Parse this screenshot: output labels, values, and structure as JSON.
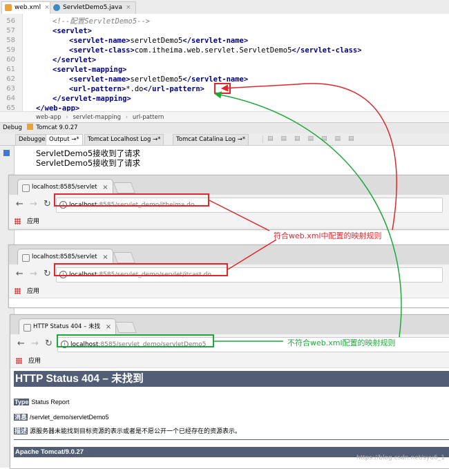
{
  "editor": {
    "tabs": [
      {
        "label": "web.xml",
        "close": "×"
      },
      {
        "label": "ServletDemo5.java",
        "close": "×"
      }
    ],
    "lines": [
      {
        "num": "56",
        "text": "<!--配置ServletDemo5-->"
      },
      {
        "num": "57",
        "text": "<servlet>"
      },
      {
        "num": "58",
        "open": "<servlet-name>",
        "value": "servletDemo5",
        "close": "</servlet-name>"
      },
      {
        "num": "59",
        "open": "<servlet-class>",
        "value": "com.itheima.web.servlet.ServletDemo5",
        "close": "</servlet-class>"
      },
      {
        "num": "60",
        "text": "</servlet>"
      },
      {
        "num": "61",
        "text": "<servlet-mapping>"
      },
      {
        "num": "62",
        "open": "<servlet-name>",
        "value": "servletDemo5",
        "close": "</servlet-name>"
      },
      {
        "num": "63",
        "open": "<url-pattern>",
        "value": "*.do",
        "close": "</url-pattern>"
      },
      {
        "num": "64",
        "text": "</servlet-mapping>"
      },
      {
        "num": "65",
        "text": "</web-app>"
      }
    ],
    "breadcrumb": [
      "web-app",
      "servlet-mapping",
      "url-pattern"
    ],
    "separator": "›"
  },
  "debug": {
    "label": "Debug",
    "config": "Tomcat 9.0.27",
    "tabs": [
      "Debugger",
      "Output →*",
      "Tomcat Localhost Log →*",
      "Tomcat Catalina Log →*"
    ],
    "console_lines": [
      "ServletDemo5接收到了请求",
      "ServletDemo5接收到了请求"
    ]
  },
  "browsers": [
    {
      "tab_title": "localhost:8585/servlet",
      "host": "localhost",
      "path": ":8585/servlet_demo/itheima.do",
      "apps": "应用"
    },
    {
      "tab_title": "localhost:8585/servlet",
      "host": "localhost",
      "path": ":8585/servlet_demo/servlet/itcast.do",
      "apps": "应用"
    },
    {
      "tab_title": "HTTP Status 404 – 未找",
      "host": "localhost",
      "path": ":8585/servlet_demo/servletDemo5",
      "apps": "应用"
    }
  ],
  "page404": {
    "heading": "HTTP Status 404 – 未找到",
    "type_label": "Type",
    "type_value": "Status Report",
    "message_label": "消息",
    "message_value": "/servlet_demo/servletDemo5",
    "desc_label": "描述",
    "desc_value": "源服务器未能找到目标资源的表示或者是不愿公开一个已经存在的资源表示。",
    "footer": "Apache Tomcat/9.0.27"
  },
  "annotations": {
    "match": "符合web.xml中配置的映射规则",
    "nomatch": "不符合web.xml配置的映射规则",
    "red": "#e0262b",
    "green": "#1fa83a"
  },
  "watermark": "https://blog.csdn.net/syu6_1"
}
